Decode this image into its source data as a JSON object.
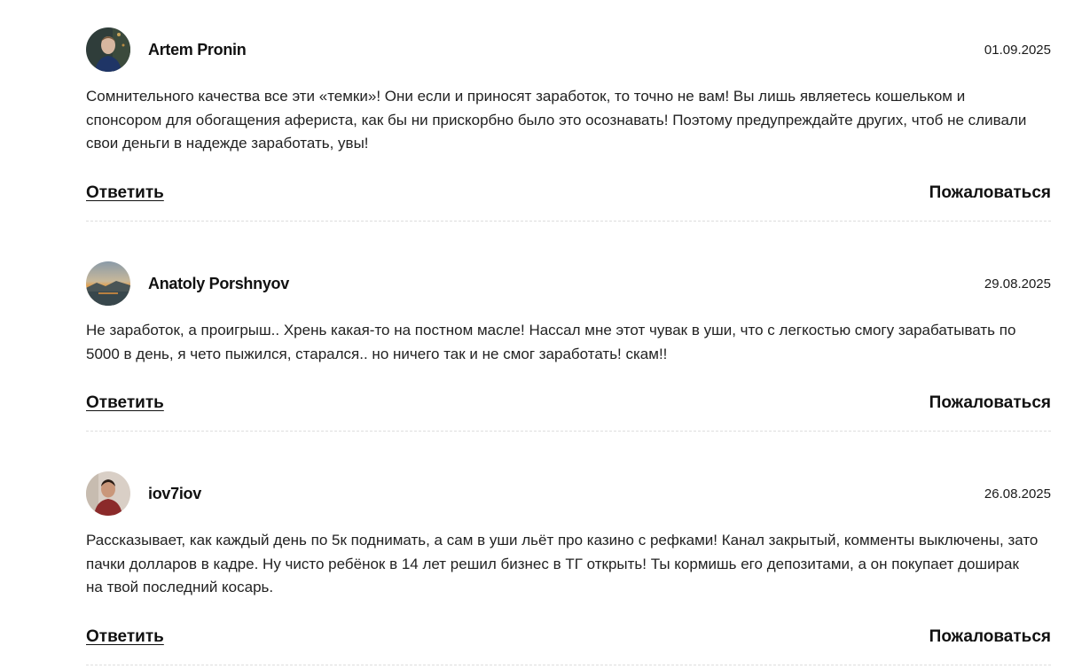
{
  "comments": [
    {
      "author": "Artem Pronin",
      "date": "01.09.2025",
      "text": "Сомнительного качества все эти «темки»! Они если и приносят заработок, то точно не вам! Вы лишь являетесь кошельком и спонсором для обогащения афериста, как бы ни прискорбно было это осознавать! Поэтому предупреждайте других, чтоб не сливали свои деньги в надежде заработать, увы!",
      "reply_label": "Ответить",
      "report_label": "Пожаловаться"
    },
    {
      "author": "Anatoly Porshnyov",
      "date": "29.08.2025",
      "text": "Не заработок, а проигрыш.. Хрень какая-то на постном масле! Нассал мне этот чувак в уши, что с легкостью смогу зарабатывать по 5000 в день, я чето пыжился, старался.. но ничего так и не смог заработать! скам!!",
      "reply_label": "Ответить",
      "report_label": "Пожаловаться"
    },
    {
      "author": "iov7iov",
      "date": "26.08.2025",
      "text": "Рассказывает, как каждый день по 5к поднимать, а сам в уши льёт про казино с рефками! Канал закрытый, комменты выключены, зато пачки долларов в кадре. Ну чисто ребёнок в 14 лет решил бизнес в ТГ открыть! Ты кормишь его депозитами, а он покупает доширак на твой последний косарь.",
      "reply_label": "Ответить",
      "report_label": "Пожаловаться"
    }
  ]
}
